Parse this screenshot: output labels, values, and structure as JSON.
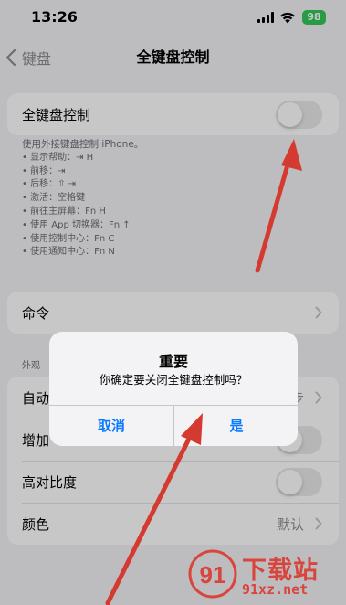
{
  "status_bar": {
    "time": "13:26",
    "battery": "98"
  },
  "nav": {
    "back_label": "键盘",
    "title": "全键盘控制"
  },
  "main_toggle": {
    "label": "全键盘控制"
  },
  "description": {
    "intro": "使用外接键盘控制 iPhone。",
    "items": [
      "• 显示帮助：⇥ H",
      "• 前移：⇥",
      "• 后移：⇧ ⇥",
      "• 激活：空格键",
      "• 前往主屏幕：Fn H",
      "• 使用 App 切换器：Fn ↑",
      "• 使用控制中心：Fn C",
      "• 使用通知中心：Fn N"
    ]
  },
  "commands": {
    "label": "命令"
  },
  "appearance": {
    "section_label": "外观",
    "rows": [
      {
        "label": "自动",
        "value": "步"
      },
      {
        "label": "增加"
      },
      {
        "label": "高对比度"
      },
      {
        "label": "颜色",
        "value": "默认"
      }
    ]
  },
  "alert": {
    "title": "重要",
    "message": "你确定要关闭全键盘控制吗？",
    "cancel_label": "取消",
    "confirm_label": "是"
  },
  "watermark": {
    "brand": "下载站",
    "url": "91xz.net",
    "logo_text": "91"
  },
  "colors": {
    "accent": "#0a7aff",
    "annotation_arrow": "#d43a2f",
    "toggle_off": "#e9e9eb"
  }
}
